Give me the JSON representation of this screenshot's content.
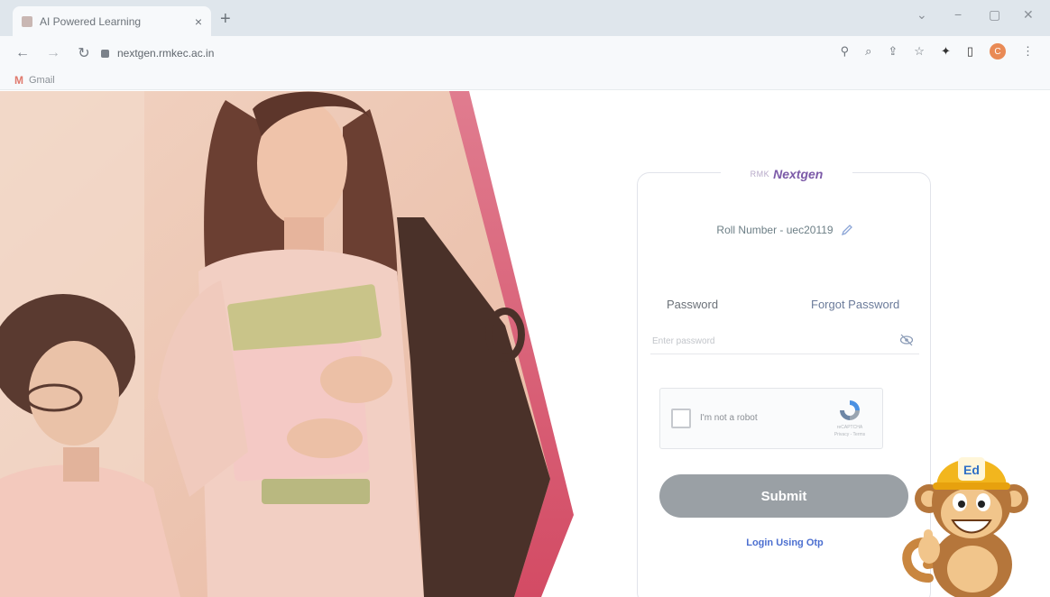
{
  "browser": {
    "tab_title": "AI Powered Learning",
    "tab_close": "×",
    "new_tab": "+",
    "url": "nextgen.rmkec.ac.in",
    "bookmark_gmail": "Gmail",
    "profile_initial": "C",
    "window_controls": [
      "⌄",
      "−",
      "▢",
      "✕"
    ],
    "icons": [
      "back-arrow-icon",
      "forward-arrow-icon",
      "reload-icon",
      "lock-icon",
      "zoom-icon",
      "search-icon",
      "share-icon",
      "star-icon",
      "extensions-icon",
      "sidebar-icon",
      "menu-icon"
    ]
  },
  "login": {
    "brand_prefix": "RMK",
    "brand_name": "Nextgen",
    "roll_number": "Roll Number - uec20119",
    "password_label": "Password",
    "forgot_password": "Forgot Password",
    "password_placeholder": "Enter password",
    "captcha_label": "I'm not a robot",
    "captcha_brand": "reCAPTCHA",
    "captcha_terms": "Privacy - Terms",
    "submit_label": "Submit",
    "otp_link": "Login Using Otp"
  },
  "mascot": {
    "badge": "Ed"
  },
  "colors": {
    "accent_pink": "#d9566f",
    "brand_purple": "#7c5aa8",
    "submit_gray": "#9aa0a5",
    "link_blue": "#4c6fd0"
  }
}
